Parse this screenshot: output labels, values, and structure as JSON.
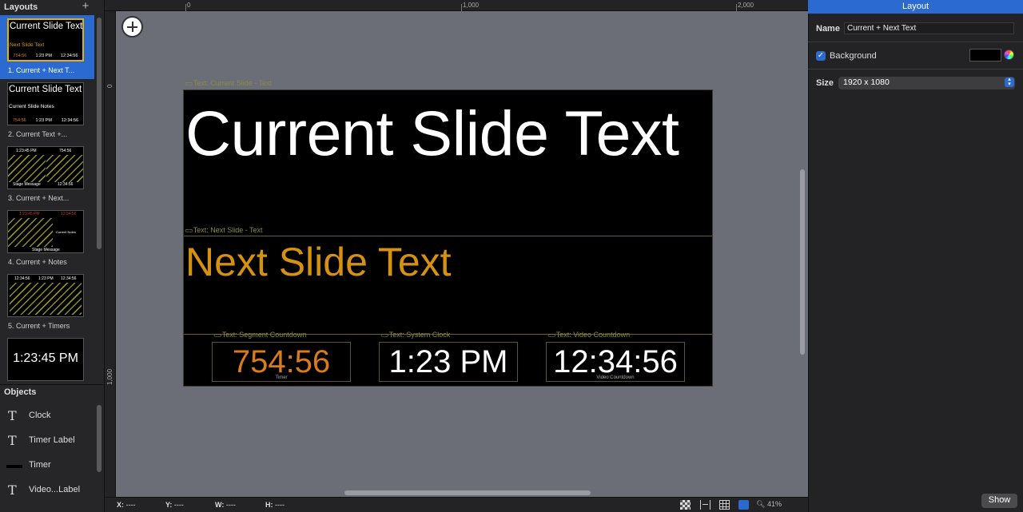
{
  "left_panel": {
    "layouts_title": "Layouts",
    "add_icon": "plus-icon",
    "layouts": [
      {
        "label": "1.  Current + Next T...",
        "selected": true,
        "big": "Current Slide Text",
        "next": "Next Slide Text",
        "row": [
          "754:56",
          "1:23 PM",
          "12:34:56"
        ]
      },
      {
        "label": "2.  Current Text +...",
        "big": "Current Slide Text",
        "notes": "Current Slide Notes",
        "row": [
          "754:56",
          "1:23 PM",
          "12:34:56"
        ]
      },
      {
        "label": "3.  Current + Next...",
        "top": [
          "1:23:45 PM",
          "754:56"
        ],
        "bottom": [
          "Stage Message",
          "12:34:56"
        ]
      },
      {
        "label": "4.  Current + Notes",
        "top": [
          "1:23:45 PM",
          "12:34:56"
        ],
        "mid": "Current Notes",
        "bottom": [
          "Stage Message"
        ]
      },
      {
        "label": "5.  Current + Timers",
        "top": [
          "12:34:56",
          "1:23 PM",
          "12:34:56"
        ]
      },
      {
        "label": "",
        "clock": "1:23:45 PM"
      }
    ],
    "objects_title": "Objects",
    "objects": [
      {
        "label": "Clock",
        "icon": "text-icon"
      },
      {
        "label": "Timer Label",
        "icon": "text-icon"
      },
      {
        "label": "Timer",
        "icon": "timer-bar-icon"
      },
      {
        "label": "Video...Label",
        "icon": "text-icon"
      }
    ]
  },
  "canvas": {
    "ruler_top": [
      "0",
      "1,000",
      "2,000"
    ],
    "ruler_left": [
      "0",
      "1,000"
    ],
    "captions": {
      "current": "Text: Current Slide - Text",
      "next": "Text: Next Slide - Text",
      "segment": "Text: Segment Countdown",
      "clock": "Text: System Clock",
      "video": "Text: Video Countdown"
    },
    "current_text": "Current Slide Text",
    "next_text": "Next Slide Text",
    "timers": [
      {
        "value": "754:56",
        "sub": "Timer",
        "color": "#d97b1a"
      },
      {
        "value": "1:23 PM",
        "sub": "",
        "color": "#ffffff"
      },
      {
        "value": "12:34:56",
        "sub": "Video Countdown",
        "color": "#ffffff"
      }
    ]
  },
  "statusbar": {
    "x": "X:",
    "x_val": "----",
    "y": "Y:",
    "y_val": "----",
    "w": "W:",
    "w_val": "----",
    "h": "H:",
    "h_val": "----",
    "zoom": "41%"
  },
  "right_panel": {
    "title": "Layout",
    "name_label": "Name",
    "name_value": "Current + Next Text",
    "background_label": "Background",
    "background_checked": true,
    "background_color": "#000000",
    "size_label": "Size",
    "size_value": "1920 x 1080",
    "show_button": "Show"
  },
  "colors": {
    "accent": "#2a6ad1",
    "next_text": "#d4920e",
    "timer_orange": "#d97b1a"
  }
}
